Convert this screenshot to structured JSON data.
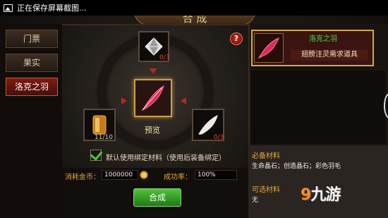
{
  "status_bar": {
    "text": "正在保存屏幕截图..."
  },
  "title": {
    "text": "合 成"
  },
  "tabs": [
    {
      "label": "门票"
    },
    {
      "label": "果实"
    },
    {
      "label": "洛克之羽"
    }
  ],
  "craft": {
    "top_slot_count": "0/3",
    "left_slot_count": "11/10",
    "right_slot_count": "0/3",
    "preview_label": "预览",
    "help_label": "?",
    "bind_checkbox_label": "默认使用绑定材料（使用后装备绑定）",
    "bind_checked": true
  },
  "cost": {
    "gold_label": "消耗金币：",
    "gold_value": "1000000",
    "rate_label": "成功率：",
    "rate_value": "100%"
  },
  "craft_button": {
    "label": "合成"
  },
  "item": {
    "name": "洛克之羽",
    "description": "翅膀注灵需求道具"
  },
  "requirements": {
    "required_title": "必备材料",
    "required_text": "生命晶石；创造晶石；彩色羽毛",
    "optional_title": "可选材料",
    "optional_text": "无"
  },
  "watermark": {
    "prefix": "9",
    "text": "九游"
  },
  "colors": {
    "accent_gold": "#d2a94a",
    "craft_green": "#4ec43a",
    "count_red": "#e04a3a",
    "active_tab": "#7a1c14"
  }
}
